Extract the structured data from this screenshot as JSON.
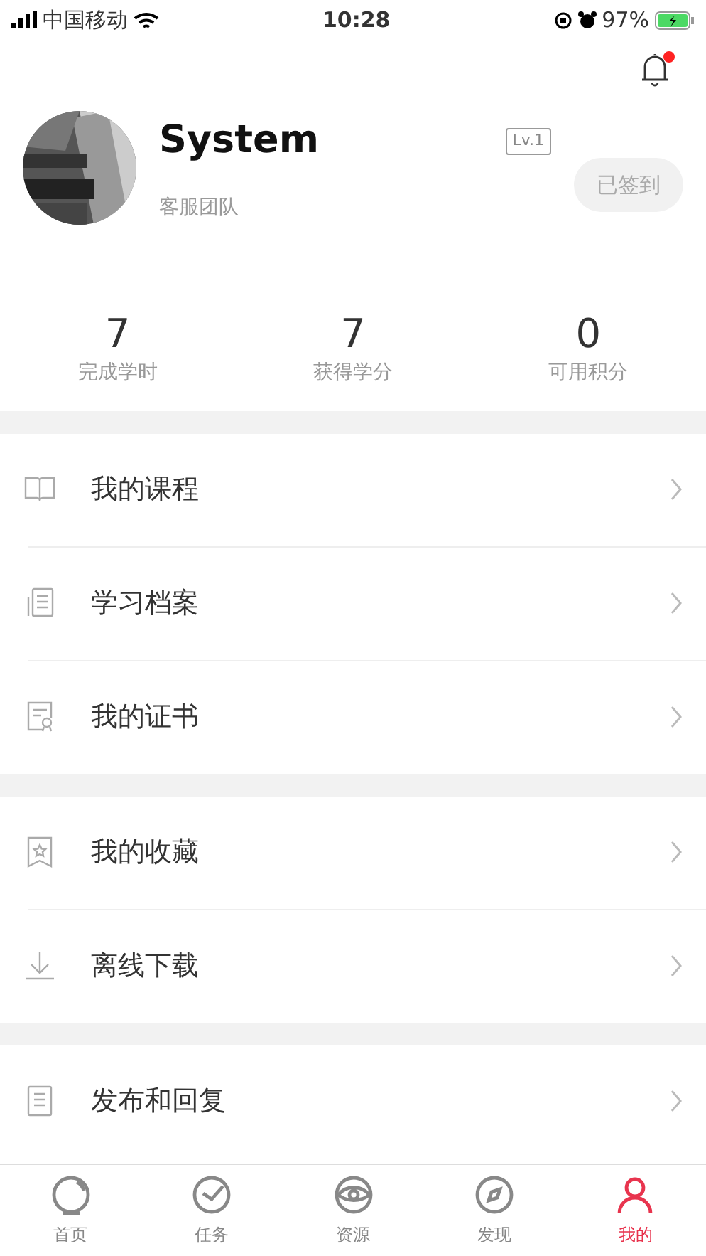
{
  "status_bar": {
    "carrier": "中国移动",
    "time": "10:28",
    "battery": "97%"
  },
  "notifications": {
    "unread": true
  },
  "profile": {
    "name": "System",
    "level": "Lv.1",
    "team": "客服团队",
    "checkin": "已签到",
    "checked_in": true
  },
  "stats": [
    {
      "value": "7",
      "label": "完成学时"
    },
    {
      "value": "7",
      "label": "获得学分"
    },
    {
      "value": "0",
      "label": "可用积分"
    }
  ],
  "menu_groups": [
    [
      {
        "kind": "book",
        "label": "我的课程"
      },
      {
        "kind": "file",
        "label": "学习档案"
      },
      {
        "kind": "certificate",
        "label": "我的证书"
      }
    ],
    [
      {
        "kind": "favorite",
        "label": "我的收藏"
      },
      {
        "kind": "download",
        "label": "离线下载"
      }
    ],
    [
      {
        "kind": "posts",
        "label": "发布和回复"
      }
    ]
  ],
  "tab_bar": [
    {
      "kind": "home",
      "label": "首页",
      "selected": false
    },
    {
      "kind": "task",
      "label": "任务",
      "selected": false
    },
    {
      "kind": "resource",
      "label": "资源",
      "selected": false
    },
    {
      "kind": "discover",
      "label": "发现",
      "selected": false
    },
    {
      "kind": "me",
      "label": "我的",
      "selected": true
    }
  ]
}
